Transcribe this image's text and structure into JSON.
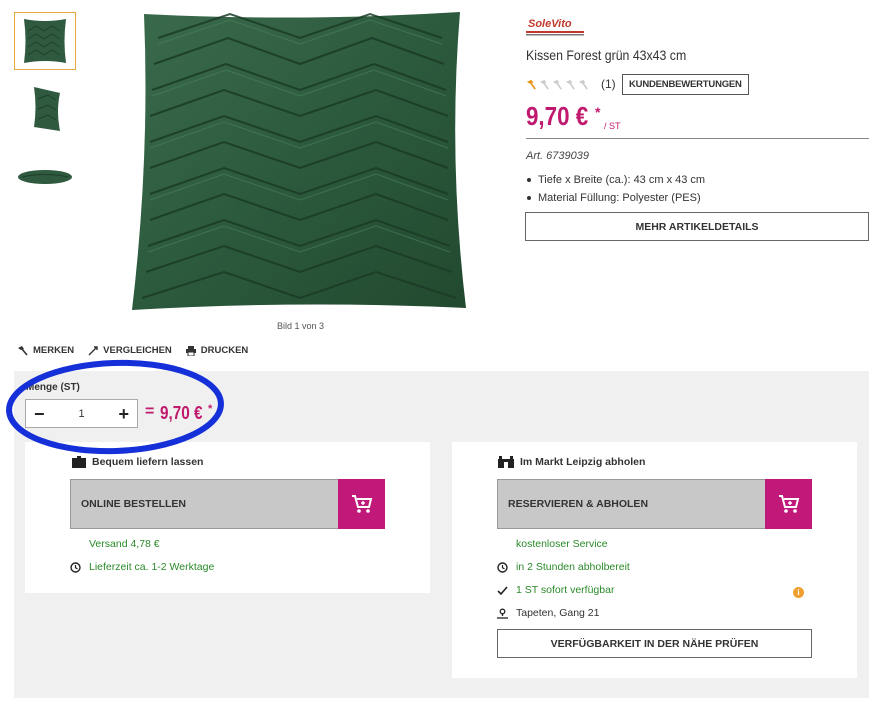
{
  "gallery": {
    "caption": "Bild 1 von 3",
    "thumbnails": [
      "front",
      "angle",
      "side"
    ]
  },
  "brand": {
    "logo_text": "SoleVito"
  },
  "product": {
    "title": "Kissen Forest grün 43x43 cm",
    "rating": {
      "stars_filled": 1,
      "stars_total": 5,
      "count": "(1)"
    },
    "reviews_button": "KUNDENBEWERTUNGEN",
    "price": "9,70 €",
    "price_star": "*",
    "price_unit": "/ ST",
    "article": "Art. 6739039",
    "specs": [
      "Tiefe x Breite (ca.): 43 cm x 43 cm",
      "Material Füllung: Polyester (PES)"
    ],
    "details_button": "MEHR ARTIKELDETAILS"
  },
  "actions": {
    "merken": "MERKEN",
    "vergleichen": "VERGLEICHEN",
    "drucken": "DRUCKEN"
  },
  "quantity": {
    "label": "Menge (ST)",
    "value": "1",
    "minus": "−",
    "plus": "+",
    "equals": "=",
    "total": "9,70 €",
    "total_star": "*"
  },
  "online": {
    "heading": "Bequem liefern lassen",
    "button": "ONLINE BESTELLEN",
    "shipping": "Versand 4,78 €",
    "delivery": "Lieferzeit ca. 1-2 Werktage"
  },
  "store": {
    "heading": "Im Markt Leipzig abholen",
    "button": "RESERVIEREN & ABHOLEN",
    "service": "kostenloser Service",
    "ready": "in 2 Stunden abholbereit",
    "stock": "1 ST sofort verfügbar",
    "location": "Tapeten, Gang 21",
    "nearby_button": "VERFÜGBARKEIT IN DER NÄHE PRÜFEN",
    "info_icon": "i"
  },
  "colors": {
    "accent": "#c0196e",
    "cart": "#c0197a",
    "success": "#2a8a2a",
    "annotation": "#1530d8",
    "pillow": "#2f5a3f"
  }
}
